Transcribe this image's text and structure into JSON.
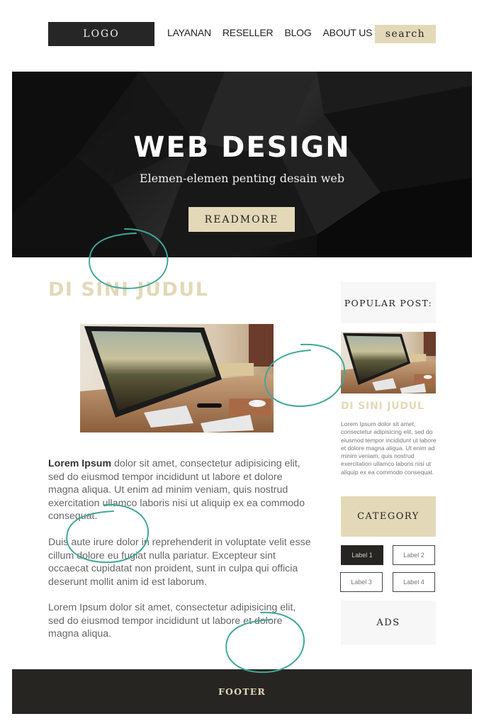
{
  "header": {
    "logo": "LOGO",
    "nav": [
      "LAYANAN",
      "RESELLER",
      "BLOG",
      "ABOUT US"
    ],
    "search_label": "search"
  },
  "hero": {
    "title": "WEB DESIGN",
    "subtitle": "Elemen-elemen penting desain web",
    "button_label": "READMORE"
  },
  "main": {
    "title": "DI SINI JUDUL",
    "image_alt": "desktop-computer-on-wooden-desk",
    "paragraphs": {
      "p1_bold": "Lorem Ipsum",
      "p1_rest": " dolor sit amet, consectetur adipisicing elit, sed do eiusmod tempor incididunt ut labore et dolore magna aliqua. Ut enim ad minim veniam, quis nostrud exercitation ullamco laboris nisi ut aliquip ex ea commodo consequat.",
      "p2": "Duis aute irure dolor in reprehenderit in voluptate velit esse cillum dolore eu fugiat nulla pariatur. Excepteur sint occaecat cupidatat non proident, sunt in culpa qui officia deserunt mollit anim id est laborum.",
      "p3": "Lorem Ipsum dolor sit amet, consectetur adipisicing elit, sed do eiusmod tempor incididunt ut labore et dolore magna aliqua."
    }
  },
  "sidebar": {
    "popular_post_label": "POPULAR POST:",
    "post_title": "DI SINI JUDUL",
    "post_excerpt": "Lorem Ipsum dolor sit amet, consectetur adipisicing elit, sed do eiusmod tempor incididunt ut labore et dolore magna aliqua. Ut enim ad minim veniam, quis nostrud exercitation ullamco laboris nisi ut aliquip ex ea commodo consequat.",
    "category_label": "CATEGORY",
    "labels": [
      {
        "text": "Label 1",
        "active": true
      },
      {
        "text": "Label 2",
        "active": false
      },
      {
        "text": "Label 3",
        "active": false
      },
      {
        "text": "Label 4",
        "active": false
      }
    ],
    "ads_label": "ADS"
  },
  "footer": {
    "label": "FOOTER"
  },
  "colors": {
    "accent_beige": "#e3d9b8",
    "dark": "#272522",
    "annotation_teal": "#3fa898"
  }
}
